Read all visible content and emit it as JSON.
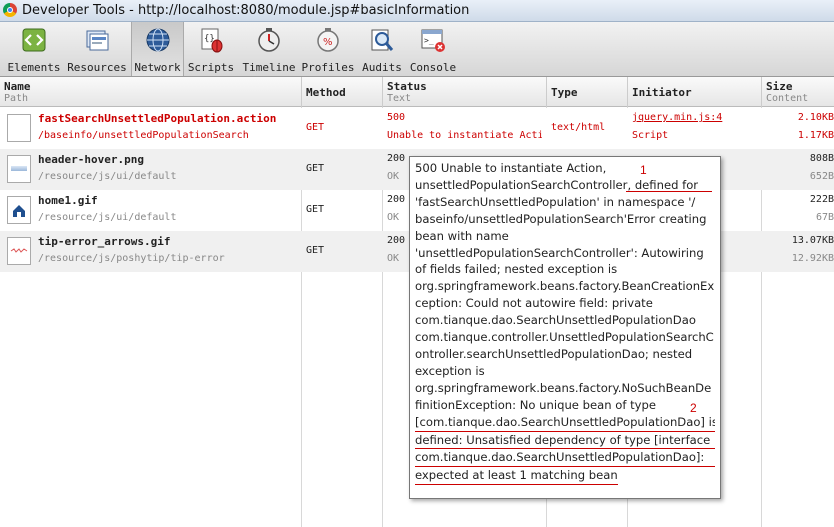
{
  "window": {
    "title": "Developer Tools - http://localhost:8080/module.jsp#basicInformation"
  },
  "toolbar": {
    "tabs": [
      {
        "label": "Elements",
        "icon": "elements-icon"
      },
      {
        "label": "Resources",
        "icon": "resources-icon"
      },
      {
        "label": "Network",
        "icon": "network-icon",
        "active": true
      },
      {
        "label": "Scripts",
        "icon": "scripts-icon"
      },
      {
        "label": "Timeline",
        "icon": "timeline-icon"
      },
      {
        "label": "Profiles",
        "icon": "profiles-icon"
      },
      {
        "label": "Audits",
        "icon": "audits-icon"
      },
      {
        "label": "Console",
        "icon": "console-icon"
      }
    ]
  },
  "columns": {
    "name": "Name",
    "name_sub": "Path",
    "method": "Method",
    "status": "Status",
    "status_sub": "Text",
    "type": "Type",
    "initiator": "Initiator",
    "size": "Size",
    "size_sub": "Content"
  },
  "rows": [
    {
      "name": "fastSearchUnsettledPopulation.action",
      "path": "/baseinfo/unsettledPopulationSearch",
      "method": "GET",
      "status": "500",
      "status_text": "Unable to instantiate Acti",
      "type": "text/html",
      "initiator": "jquery.min.js:4",
      "initiator_sub": "Script",
      "size": "2.10KB",
      "content": "1.17KB",
      "error": true,
      "icon": "document-icon"
    },
    {
      "name": "header-hover.png",
      "path": "/resource/js/ui/default",
      "method": "GET",
      "status": "200",
      "status_text": "OK",
      "size": "808B",
      "content": "652B",
      "icon": "image-icon"
    },
    {
      "name": "home1.gif",
      "path": "/resource/js/ui/default",
      "method": "GET",
      "status": "200",
      "status_text": "OK",
      "size": "222B",
      "content": "67B",
      "icon": "home-icon"
    },
    {
      "name": "tip-error_arrows.gif",
      "path": "/resource/js/poshytip/tip-error",
      "method": "GET",
      "status": "200",
      "status_text": "OK",
      "size": "13.07KB",
      "content": "12.92KB",
      "icon": "arrows-image-icon"
    }
  ],
  "tooltip": {
    "lines": [
      "500 Unable to instantiate Action,",
      "unsettledPopulationSearchController,  defined for",
      "'fastSearchUnsettledPopulation' in namespace '/",
      "baseinfo/unsettledPopulationSearch'Error creating",
      "bean with name",
      "'unsettledPopulationSearchController': Autowiring",
      "of fields failed; nested exception is",
      "org.springframework.beans.factory.BeanCreationEx",
      "ception: Could not autowire field: private",
      "com.tianque.dao.SearchUnsettledPopulationDao",
      "com.tianque.controller.UnsettledPopulationSearchC",
      "ontroller.searchUnsettledPopulationDao; nested",
      "exception is",
      "org.springframework.beans.factory.NoSuchBeanDe",
      "finitionException: No unique bean of type",
      "[com.tianque.dao.SearchUnsettledPopulationDao] is",
      "defined: Unsatisfied dependency of type [interface",
      "com.tianque.dao.SearchUnsettledPopulationDao]:",
      "expected at least 1 matching bean"
    ],
    "annotations": [
      "1",
      "2"
    ]
  },
  "colors": {
    "error": "#cc0000",
    "annotation": "#cc0000"
  }
}
